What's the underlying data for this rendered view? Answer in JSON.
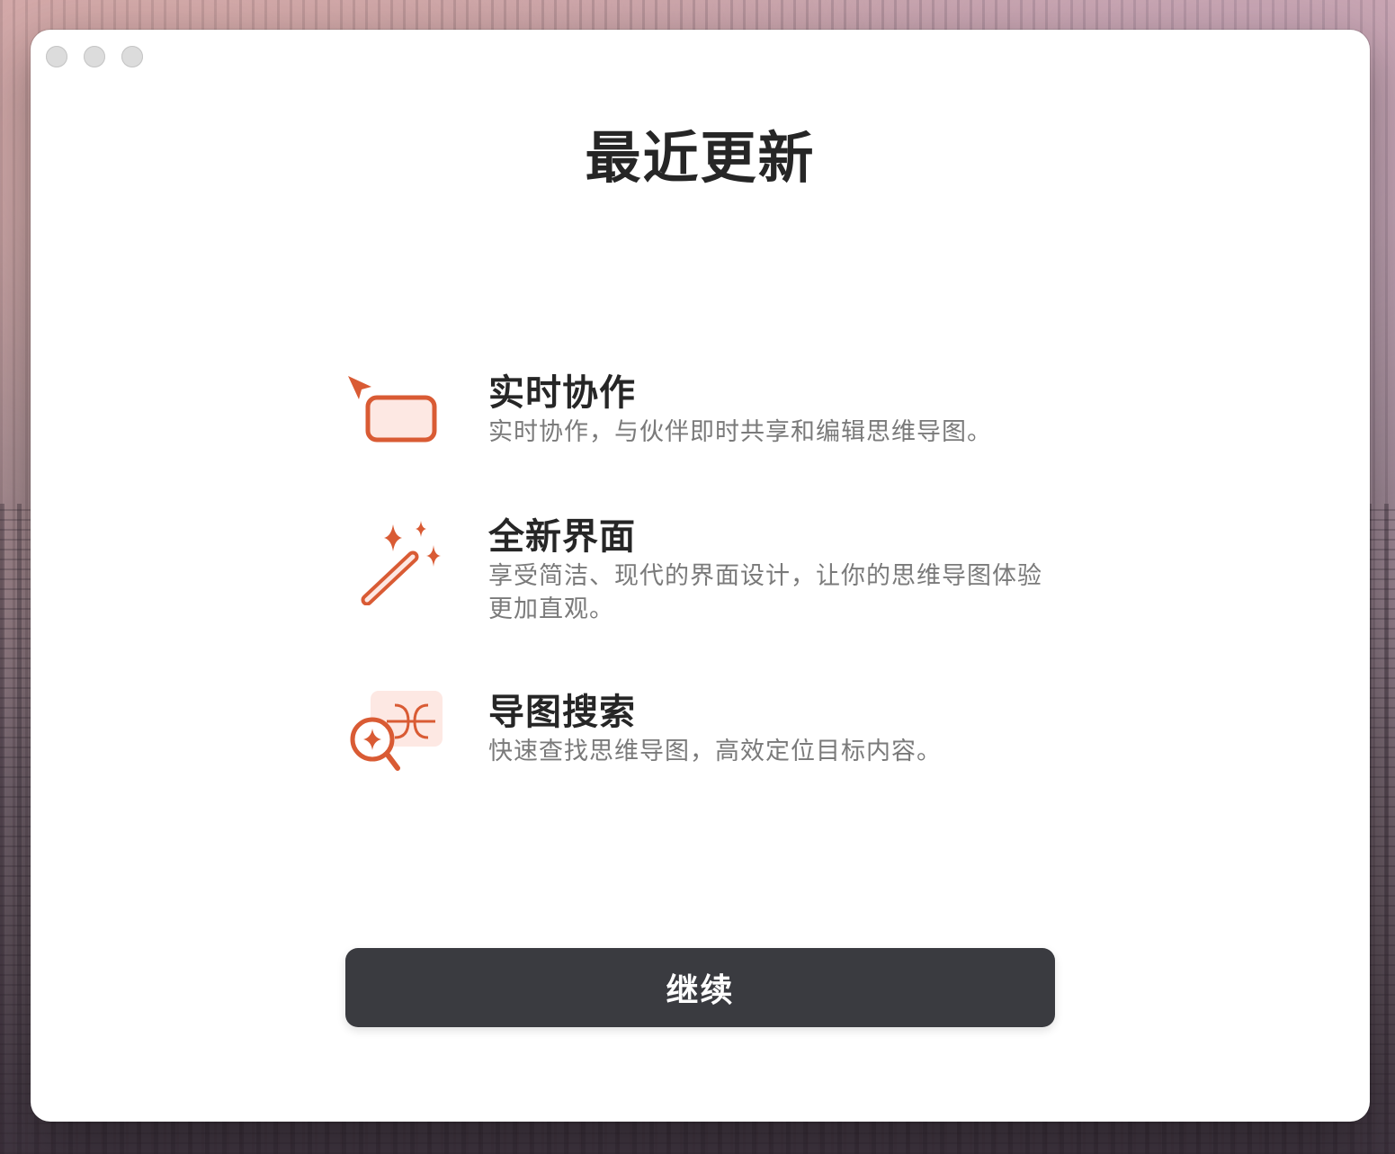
{
  "window": {
    "title": "最近更新"
  },
  "features": [
    {
      "title": "实时协作",
      "description": "实时协作，与伙伴即时共享和编辑思维导图。",
      "icon": "collaboration-cursor-icon"
    },
    {
      "title": "全新界面",
      "description": "享受简洁、现代的界面设计，让你的思维导图体验更加直观。",
      "icon": "magic-wand-icon"
    },
    {
      "title": "导图搜索",
      "description": "快速查找思维导图，高效定位目标内容。",
      "icon": "map-search-icon"
    }
  ],
  "continue_button": {
    "label": "继续"
  },
  "colors": {
    "accent": "#d95b34",
    "accent_light": "#fde8e3",
    "button_bg": "#3a3b40",
    "title_text": "#262626",
    "desc_text": "#7a7a7a"
  }
}
